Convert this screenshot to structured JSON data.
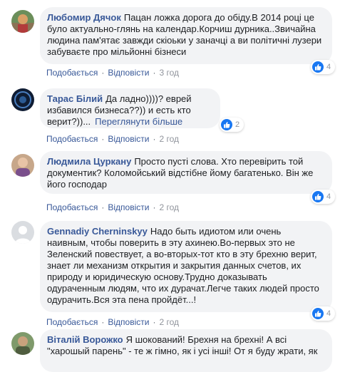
{
  "actions": {
    "like": "Подобається",
    "reply": "Відповісти",
    "separator": "·"
  },
  "comments": [
    {
      "author": "Любомир Дячок",
      "text": "Пацан ложка дорога до обіду.В 2014 році це було актуально-глянь на календар.Корчиш дурника..Звичайна людина пам'ятає завжди скіоьки у заначці а ви політичні лузери забуваєте про мільйонні бізнеси",
      "time": "3 год",
      "reactions": "4",
      "avatar_icon": "user-photo-avatar"
    },
    {
      "author": "Тарас Білий",
      "text": "Да ладно))))? еврей избавился бизнеса??)) и есть кто верит?))...",
      "see_more": "Переглянути більше",
      "time": "2 год",
      "reactions": "2",
      "avatar_icon": "user-photo-avatar"
    },
    {
      "author": "Людмила Цуркану",
      "text": "Просто пусті слова. Хто перевірить той документик? Коломойський відстібне йому багатенько. Він же його господар",
      "time": "2 год",
      "reactions": "4",
      "avatar_icon": "user-photo-avatar"
    },
    {
      "author": "Gennadiy Cherninskyy",
      "text": "Надо быть идиотом или очень наивным, чтобы поверить в эту ахинею.Во-первых это не Зеленский повествует, а во-вторых-тот кто в эту брехню верит, знает ли механизм открытия и закрытия данных счетов, их природу и юридическую основу.Трудно доказывать одураченным людям, что их дурачат.Легче таких людей просто одурачить.Вся эта пена пройдёт...!",
      "time": "2 год",
      "reactions": "4",
      "avatar_icon": "default-avatar"
    },
    {
      "author": "Віталій Ворожко",
      "text": "Я шокований! Брехня на брехні! А всі \"харошый парень\" - те ж гімно, як і усі інші! От я буду жрати, як"
    }
  ],
  "colors": {
    "link": "#385898",
    "like_blue": "#1877f2",
    "bubble": "#f2f3f5"
  }
}
